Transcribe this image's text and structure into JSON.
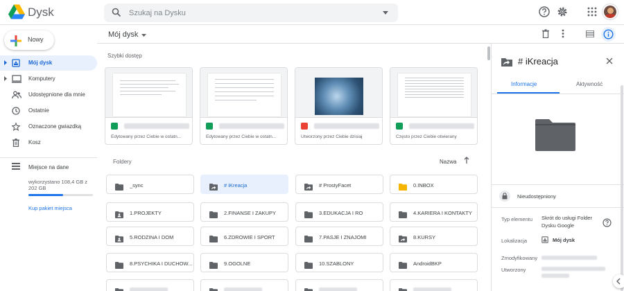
{
  "app": {
    "name": "Dysk"
  },
  "search": {
    "placeholder": "Szukaj na Dysku"
  },
  "header": {
    "icons": [
      "help-icon",
      "settings-icon",
      "apps-icon",
      "avatar"
    ]
  },
  "sidebar": {
    "new_label": "Nowy",
    "items": [
      {
        "label": "Mój dysk",
        "icon": "my-drive-icon",
        "selected": true
      },
      {
        "label": "Komputery",
        "icon": "computer-icon"
      },
      {
        "label": "Udostępnione dla mnie",
        "icon": "shared-icon"
      },
      {
        "label": "Ostatnie",
        "icon": "clock-icon"
      },
      {
        "label": "Oznaczone gwiazdką",
        "icon": "star-icon"
      },
      {
        "label": "Kosz",
        "icon": "trash-icon"
      }
    ],
    "storage": {
      "label": "Miejsce na dane",
      "usage": "wykorzystano 108,4 GB z 202 GB",
      "fraction": 0.54,
      "buy": "Kup pakiet miejsca"
    }
  },
  "toolbar": {
    "breadcrumb": "Mój dysk"
  },
  "quick_access": {
    "title": "Szybki dostęp",
    "cards": [
      {
        "type": "sheet",
        "subtitle": "Edytowany przez Ciebie w ostatn..."
      },
      {
        "type": "sheet",
        "subtitle": "Edytowany przez Ciebie w ostatn..."
      },
      {
        "type": "pdf",
        "subtitle": "Utworzony przez Ciebie dzisiaj"
      },
      {
        "type": "sheet",
        "subtitle": "Często przez Ciebie otwierany"
      }
    ]
  },
  "folders": {
    "title": "Foldery",
    "sort_label": "Nazwa",
    "items": [
      {
        "label": "_sync",
        "kind": "folder"
      },
      {
        "label": "# iKreacja",
        "kind": "shortcut",
        "selected": true
      },
      {
        "label": "# ProstyFacet",
        "kind": "shortcut"
      },
      {
        "label": "0.INBOX",
        "kind": "folder-yellow"
      },
      {
        "label": "1.PROJEKTY",
        "kind": "shared-folder"
      },
      {
        "label": "2.FINANSE I ZAKUPY",
        "kind": "folder"
      },
      {
        "label": "3.EDUKACJA I RO",
        "kind": "folder"
      },
      {
        "label": "4.KARIERA I KONTAKTY",
        "kind": "folder"
      },
      {
        "label": "5.RODZINA I DOM",
        "kind": "shared-folder"
      },
      {
        "label": "6.ZDROWIE I SPORT",
        "kind": "folder"
      },
      {
        "label": "7.PASJE I ZNAJOMI",
        "kind": "folder"
      },
      {
        "label": "8.KURSY",
        "kind": "shortcut"
      },
      {
        "label": "8.PSYCHIKA I DUCHOW...",
        "kind": "folder"
      },
      {
        "label": "9.OGOLNE",
        "kind": "folder"
      },
      {
        "label": "10.SZABLONY",
        "kind": "folder"
      },
      {
        "label": "AndroidBKP",
        "kind": "folder"
      }
    ]
  },
  "details": {
    "title": "# iKreacja",
    "tabs": [
      "Informacje",
      "Aktywność"
    ],
    "sharing": "Nieudostępniony",
    "type_label": "Typ elementu",
    "type_value": "Skrót do usługi Folder Dysku Google",
    "location_label": "Lokalizacja",
    "location_value": "Mój dysk",
    "modified_label": "Zmodyfikowany",
    "created_label": "Utworzony"
  },
  "colors": {
    "accent": "#1a73e8",
    "selected_bg": "#e8f0fe",
    "folder": "#5f6368",
    "sheet": "#0f9d58",
    "pdf": "#ea4335",
    "inbox": "#f4b400"
  }
}
